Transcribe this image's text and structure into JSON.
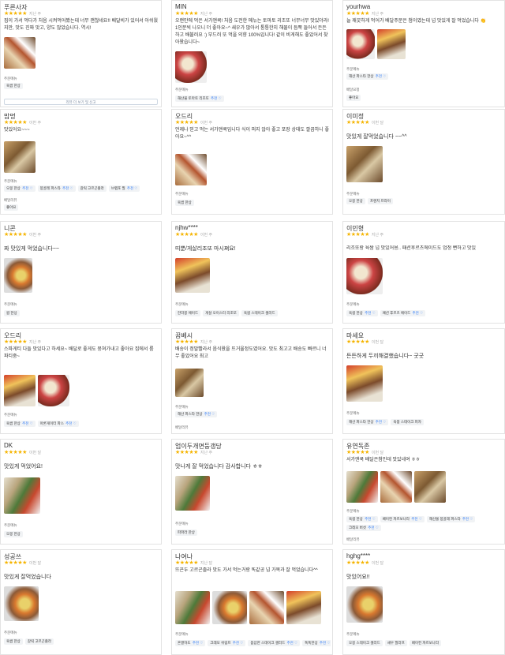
{
  "reviews": [
    {
      "name": "푸른사자",
      "date": "지난 주",
      "stars": "★★★★★",
      "text": "집이 가서 먹다가 처음 시켜먹어봤는데 너무 괜찮네요!! 배달비가 있어서 아쉬웠지만, 맛도 진짜 맛고, 양도 많았습니다. 역시!",
      "menu_label": "주문메뉴",
      "tags": [
        "육쌈 한상"
      ],
      "more": "리뷰 더 보기 및 신고"
    },
    {
      "name": "MIN",
      "date": "지난 주",
      "stars": "★★★★★",
      "text": "오랜만에 먹은 서가앤쿡! 처음 도전한 메뉴는 토마토 리조또 너무너무 맛있더라! 1인분씩 나오니 더 좋아요~^ 새우가 많아서 통통한지 해물이 듬뿍 들어서 든든하고 배불러요 :) 부드러 또 먹을 의향 100%입니다! 같이 비게해도 좋았어서 찾아왔습니다~",
      "menu_label": "주문메뉴",
      "tags": [
        "해산물 토마토 리조또"
      ]
    },
    {
      "name": "yourhwa",
      "date": "지난 주",
      "stars": "★★★★★",
      "text": "늘 깨끗하게 먹어가 배달주문은 첨이였는데 넘 맛있게 잘 먹었습니다 👏",
      "menu_label": "주문메뉴",
      "tags": [
        "해산 파스타 한상"
      ],
      "sub_label": "배달요청",
      "sub_tags": [
        "좋아요"
      ]
    },
    {
      "name": "맘멍",
      "date": "이번 주",
      "stars": "★★★★★",
      "text": "맛있어요~~~",
      "menu_label": "주문메뉴",
      "tags": [
        "오몽 한상",
        "봉골레 파스타",
        "갈릭 고르곤졸라",
        "브랩포 필"
      ],
      "sub_label": "배달리뷰",
      "sub_tags": [
        "좋아요"
      ]
    },
    {
      "name": "오드리",
      "date": "이번 주",
      "stars": "★★★★★",
      "text": "언제나 믿고 먹는 서가앤쿡입니다 식이 퍼지 않아 좋고 포장 상태도 깔끔하니 좋아요~^^",
      "menu_label": "주문메뉴",
      "tags": [
        "육쌈 한상"
      ]
    },
    {
      "name": "이미정",
      "date": "이번 달",
      "stars": "★★★★★",
      "text": "맛있게 잘먹었습니다 ~~^^",
      "menu_label": "주문메뉴",
      "tags": [
        "오몽 한상",
        "프렌치 프라이"
      ]
    },
    {
      "name": "니콘",
      "date": "이번 주",
      "stars": "★★★★★",
      "text": "짜 맛있게 먹었습니다~~",
      "menu_label": "주문메뉴",
      "tags": [
        "쌈 한상"
      ]
    },
    {
      "name": "njhw****",
      "date": "이번 주",
      "stars": "★★★★★",
      "text": "띠뿐/게살리조또 마시쪄요!",
      "menu_label": "주문메뉴",
      "tags": [
        "한라봉 에이드",
        "게살 오이스터 리조또",
        "육쌈 스테이크 샐러드"
      ]
    },
    {
      "name": "이민형",
      "date": "지난 주",
      "stars": "★★★★★",
      "text": "리조또랑 육쌈 넘 맛있어용.. 패션후르츠에이드도 엄청 뻔하고 맛있",
      "menu_label": "주문메뉴",
      "tags": [
        "육쌈 한상",
        "패션 후르츠 에이드"
      ]
    },
    {
      "name": "오드리",
      "date": "지난 주",
      "stars": "★★★★★",
      "text": "스파게티 다들 맛있다고 하세요~ 배달로 좋게도 뭉쳐가내고 좋아요 집에서 룸파티중~",
      "menu_label": "주문메뉴",
      "tags": [
        "육쌈 한상",
        "아론게이터 파스"
      ]
    },
    {
      "name": "꿈베시",
      "date": "지난 주",
      "stars": "★★★★★",
      "text": "배송이 정말빨라서 음식왔을 뜨거울정도였어요. 맛도 최고고 배송도 빠르니 너무 좋았어요 최고",
      "menu_label": "주문메뉴",
      "tags": [
        "해산 파스타 한상"
      ],
      "sub_label": "배달리뷰"
    },
    {
      "name": "마세요",
      "date": "이번 달",
      "stars": "★★★★★",
      "text": "든든하게 두끼해결했습니다~ 굿굿",
      "menu_label": "주문메뉴",
      "tags": [
        "해산 파스타 한상",
        "육쌈 스테이크 피자"
      ]
    },
    {
      "name": "DK",
      "date": "이번 달",
      "stars": "★★★★★",
      "text": "맛있게 먹었어요!",
      "menu_label": "주문메뉴",
      "tags": [
        "오몽 한상"
      ]
    },
    {
      "name": "엄이두개면둥갱당",
      "date": "지난 주",
      "stars": "★★★★★",
      "text": "맛나게 잘 먹었습니다 감사합니다 ㅎㅎ",
      "menu_label": "주문메뉴",
      "tags": [
        "파파라 한상"
      ]
    },
    {
      "name": "유연독존",
      "date": "이번 달",
      "stars": "★★★★★",
      "text": "서가앤쿡 배달은첨인데 맛있네여 ㅎㅎ",
      "menu_label": "주문메뉴",
      "tags": [
        "육쌈 한상",
        "베이컨 까르보나라",
        "해산물 봉골레 파스타"
      ],
      "tags2": [
        "크레모 버섯"
      ],
      "sub_label": "배달리뷰"
    },
    {
      "name": "성공쓰",
      "date": "이번 달",
      "stars": "★★★★★",
      "text": "맛있게 잘먹었습니다",
      "menu_label": "주문메뉴",
      "tags": [
        "육쌈 한상",
        "갈릭 고르곤졸라"
      ]
    },
    {
      "name": "나여나",
      "date": "지난 달",
      "stars": "★★★★★",
      "text": "뜨끈두 고르곤졸라 맛도 가서 먹는거랑 똑같공 넘 가목과 잘 먹었습니다^^",
      "menu_label": "주문메뉴",
      "tags": [
        "흔쌀하도",
        "크레모 쉬림프",
        "봄삽한 스테이크 샐러드",
        "톡톡한상"
      ]
    },
    {
      "name": "hghg****",
      "date": "이번 달",
      "stars": "★★★★★",
      "text": "맛있어요!!",
      "menu_label": "주문메뉴",
      "tags": [
        "오몽 스테이크 샐러드",
        "새우 필라프",
        "베이컨 까르보나라"
      ]
    }
  ],
  "rec_label": "추천 ♡"
}
